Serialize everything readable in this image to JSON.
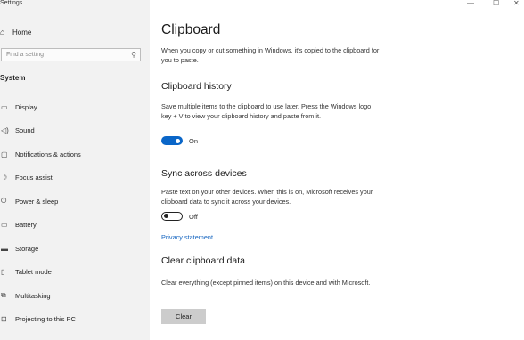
{
  "window": {
    "title": "Settings",
    "minimize_glyph": "—",
    "maximize_glyph": "☐",
    "close_glyph": "✕"
  },
  "sidebar": {
    "home_icon": "home-icon",
    "home_label": "Home",
    "search_placeholder": "Find a setting",
    "search_icon": "search-icon",
    "section_label": "System",
    "items": [
      {
        "label": "Display",
        "icon": "display-icon"
      },
      {
        "label": "Sound",
        "icon": "sound-icon"
      },
      {
        "label": "Notifications & actions",
        "icon": "notifications-icon"
      },
      {
        "label": "Focus assist",
        "icon": "focus-assist-icon"
      },
      {
        "label": "Power & sleep",
        "icon": "power-icon"
      },
      {
        "label": "Battery",
        "icon": "battery-icon"
      },
      {
        "label": "Storage",
        "icon": "storage-icon"
      },
      {
        "label": "Tablet mode",
        "icon": "tablet-mode-icon"
      },
      {
        "label": "Multitasking",
        "icon": "multitasking-icon"
      },
      {
        "label": "Projecting to this PC",
        "icon": "projecting-icon"
      }
    ]
  },
  "main": {
    "title": "Clipboard",
    "intro": "When you copy or cut something in Windows, it's copied to the clipboard for you to paste.",
    "history": {
      "heading": "Clipboard history",
      "description": "Save multiple items to the clipboard to use later. Press the Windows logo key + V to view your clipboard history and paste from it.",
      "toggle_state": "On"
    },
    "sync": {
      "heading": "Sync across devices",
      "description": "Paste text on your other devices. When this is on, Microsoft receives your clipboard data to sync it across your devices.",
      "toggle_state": "Off"
    },
    "privacy_link": "Privacy statement",
    "clear": {
      "heading": "Clear clipboard data",
      "description": "Clear everything (except pinned items) on this device and with Microsoft.",
      "button_label": "Clear"
    }
  },
  "colors": {
    "sidebar_bg": "#f2f2f2",
    "accent": "#0a66c8",
    "link": "#1565c0",
    "button_bg": "#cccccc"
  }
}
